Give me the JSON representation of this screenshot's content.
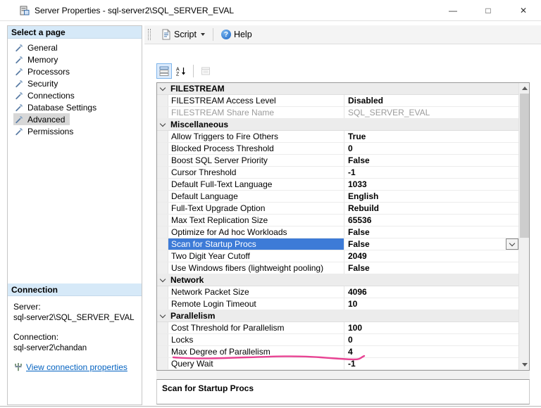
{
  "window": {
    "title": "Server Properties - sql-server2\\SQL_SERVER_EVAL",
    "controls": {
      "minimize": "—",
      "maximize": "□",
      "close": "✕"
    }
  },
  "toolbar": {
    "script_label": "Script",
    "help_label": "Help",
    "help_glyph": "?"
  },
  "sidebar": {
    "select_page_header": "Select a page",
    "items": [
      {
        "label": "General",
        "selected": false
      },
      {
        "label": "Memory",
        "selected": false
      },
      {
        "label": "Processors",
        "selected": false
      },
      {
        "label": "Security",
        "selected": false
      },
      {
        "label": "Connections",
        "selected": false
      },
      {
        "label": "Database Settings",
        "selected": false
      },
      {
        "label": "Advanced",
        "selected": true
      },
      {
        "label": "Permissions",
        "selected": false
      }
    ],
    "connection_header": "Connection",
    "server_label": "Server:",
    "server_value": "sql-server2\\SQL_SERVER_EVAL",
    "connection_label": "Connection:",
    "connection_value": "sql-server2\\chandan",
    "view_connection_link": "View connection properties"
  },
  "grid": {
    "rows": [
      {
        "type": "category",
        "label": "FILESTREAM"
      },
      {
        "type": "property",
        "label": "FILESTREAM Access Level",
        "value": "Disabled"
      },
      {
        "type": "property",
        "label": "FILESTREAM Share Name",
        "value": "SQL_SERVER_EVAL",
        "state": "disabled"
      },
      {
        "type": "category",
        "label": "Miscellaneous"
      },
      {
        "type": "property",
        "label": "Allow Triggers to Fire Others",
        "value": "True"
      },
      {
        "type": "property",
        "label": "Blocked Process Threshold",
        "value": "0"
      },
      {
        "type": "property",
        "label": "Boost SQL Server Priority",
        "value": "False"
      },
      {
        "type": "property",
        "label": "Cursor Threshold",
        "value": "-1"
      },
      {
        "type": "property",
        "label": "Default Full-Text Language",
        "value": "1033"
      },
      {
        "type": "property",
        "label": "Default Language",
        "value": "English"
      },
      {
        "type": "property",
        "label": "Full-Text Upgrade Option",
        "value": "Rebuild"
      },
      {
        "type": "property",
        "label": "Max Text Replication Size",
        "value": "65536"
      },
      {
        "type": "property",
        "label": "Optimize for Ad hoc Workloads",
        "value": "False"
      },
      {
        "type": "property",
        "label": "Scan for Startup Procs",
        "value": "False",
        "state": "selected",
        "has_dropdown": true
      },
      {
        "type": "property",
        "label": "Two Digit Year Cutoff",
        "value": "2049"
      },
      {
        "type": "property",
        "label": "Use Windows fibers (lightweight pooling)",
        "value": "False"
      },
      {
        "type": "category",
        "label": "Network"
      },
      {
        "type": "property",
        "label": "Network Packet Size",
        "value": "4096"
      },
      {
        "type": "property",
        "label": "Remote Login Timeout",
        "value": "10"
      },
      {
        "type": "category",
        "label": "Parallelism"
      },
      {
        "type": "property",
        "label": "Cost Threshold for Parallelism",
        "value": "100"
      },
      {
        "type": "property",
        "label": "Locks",
        "value": "0"
      },
      {
        "type": "property",
        "label": "Max Degree of Parallelism",
        "value": "4",
        "annotated": true
      },
      {
        "type": "property",
        "label": "Query Wait",
        "value": "-1"
      }
    ],
    "description_title": "Scan for Startup Procs"
  },
  "annotation": {
    "color": "#e84393"
  },
  "colors": {
    "selection": "#3d7bd7",
    "link": "#0563c1",
    "caption_bg": "#d6e9f8"
  }
}
